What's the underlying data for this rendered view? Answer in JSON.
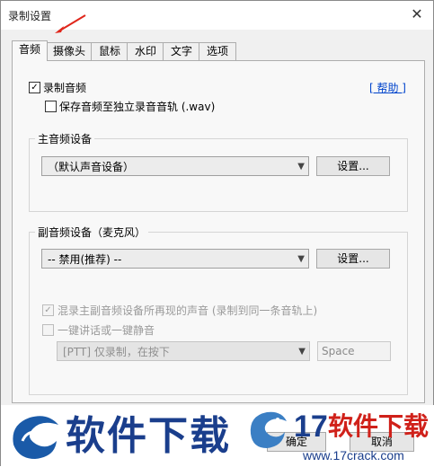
{
  "window": {
    "title": "录制设置",
    "close_glyph": "✕"
  },
  "tabs": [
    {
      "label": "音频",
      "active": true
    },
    {
      "label": "摄像头",
      "active": false
    },
    {
      "label": "鼠标",
      "active": false
    },
    {
      "label": "水印",
      "active": false
    },
    {
      "label": "文字",
      "active": false
    },
    {
      "label": "选项",
      "active": false
    }
  ],
  "audio": {
    "record_audio_label": "录制音频",
    "record_audio_checked": true,
    "save_separate_label": "保存音频至独立录音音轨 (.wav)",
    "save_separate_checked": false,
    "help_label": "[ 帮助 ]",
    "primary": {
      "group_label": "主音频设备",
      "device": "（默认声音设备）",
      "settings_label": "设置..."
    },
    "secondary": {
      "group_label": "副音频设备（麦克风）",
      "device": "-- 禁用(推荐) --",
      "settings_label": "设置..."
    },
    "mix_label": "混录主副音频设备所再现的声音 (录制到同一条音轨上)",
    "mix_checked": true,
    "ptt_label": "一键讲话或一键静音",
    "ptt_checked": false,
    "ptt_mode": "[PTT] 仅录制，在按下",
    "ptt_key": "Space"
  },
  "footer": {
    "ok_label": "确定",
    "cancel_label": "取消"
  },
  "watermark": {
    "left_text": "软件下载",
    "right_number": "17",
    "right_text": "软件下载",
    "url": "www.17crack.com"
  },
  "colors": {
    "arrow": "#e0261b",
    "watermark_blue": "#1a3e8c",
    "watermark_red": "#d0211a"
  },
  "icons": {
    "annotation": "red-arrow-icon",
    "logo": "dragon-logo-icon"
  }
}
